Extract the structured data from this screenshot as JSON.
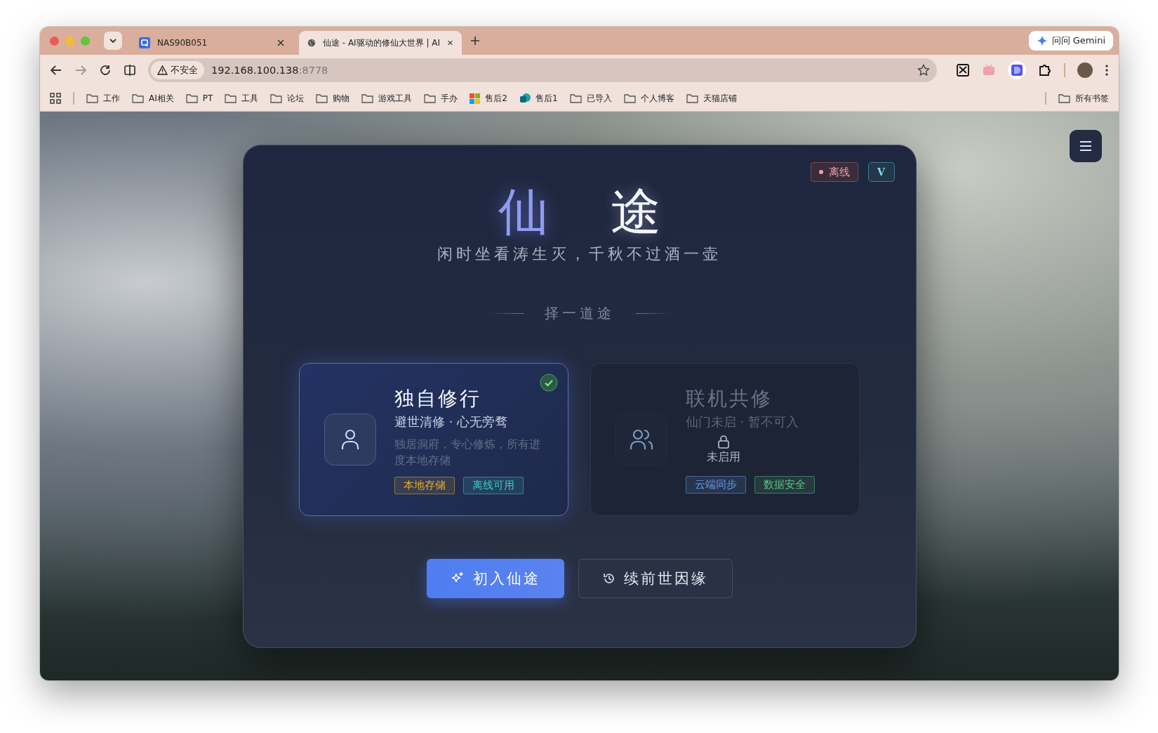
{
  "browser": {
    "tabs": [
      {
        "title": "NAS90B051",
        "selected": false
      },
      {
        "title": "仙途 - AI驱动的修仙大世界 | AI",
        "selected": true
      }
    ],
    "gemini_button": "问问 Gemini",
    "address": {
      "security": "不安全",
      "host": "192.168.100.138",
      "port": ":8778"
    },
    "bookmarks": [
      {
        "label": "工作",
        "kind": "folder"
      },
      {
        "label": "AI相关",
        "kind": "folder"
      },
      {
        "label": "PT",
        "kind": "folder"
      },
      {
        "label": "工具",
        "kind": "folder"
      },
      {
        "label": "论坛",
        "kind": "folder"
      },
      {
        "label": "购物",
        "kind": "folder"
      },
      {
        "label": "游戏工具",
        "kind": "folder"
      },
      {
        "label": "手办",
        "kind": "folder"
      },
      {
        "label": "售后2",
        "kind": "grid"
      },
      {
        "label": "售后1",
        "kind": "site"
      },
      {
        "label": "已导入",
        "kind": "folder"
      },
      {
        "label": "个人博客",
        "kind": "folder"
      },
      {
        "label": "天猫店铺",
        "kind": "folder"
      }
    ],
    "all_bookmarks": "所有书签"
  },
  "page": {
    "status_badge": {
      "label": "离线",
      "online": false
    },
    "version_badge": "V",
    "title": [
      "仙",
      "途"
    ],
    "subtitle": "闲时坐看涛生灭，千秋不过酒一壶",
    "section_title": "择一道途",
    "modes": [
      {
        "title": "独自修行",
        "subtitle": "避世清修 · 心无旁骛",
        "description": "独居洞府，专心修炼，所有进度本地存储",
        "selected": true,
        "locked": false,
        "tags": [
          {
            "label": "本地存储",
            "color": "#e0b030"
          },
          {
            "label": "离线可用",
            "color": "#40c8c0"
          }
        ]
      },
      {
        "title": "联机共修",
        "subtitle": "仙门未启 · 暂不可入",
        "selected": false,
        "locked": true,
        "lock_label": "未启用",
        "tags": [
          {
            "label": "云端同步",
            "color": "#6a9ae8"
          },
          {
            "label": "数据安全",
            "color": "#5cc080"
          }
        ]
      }
    ],
    "buttons": [
      {
        "label": "初入仙途",
        "kind": "primary"
      },
      {
        "label": "续前世因缘",
        "kind": "secondary"
      }
    ]
  }
}
